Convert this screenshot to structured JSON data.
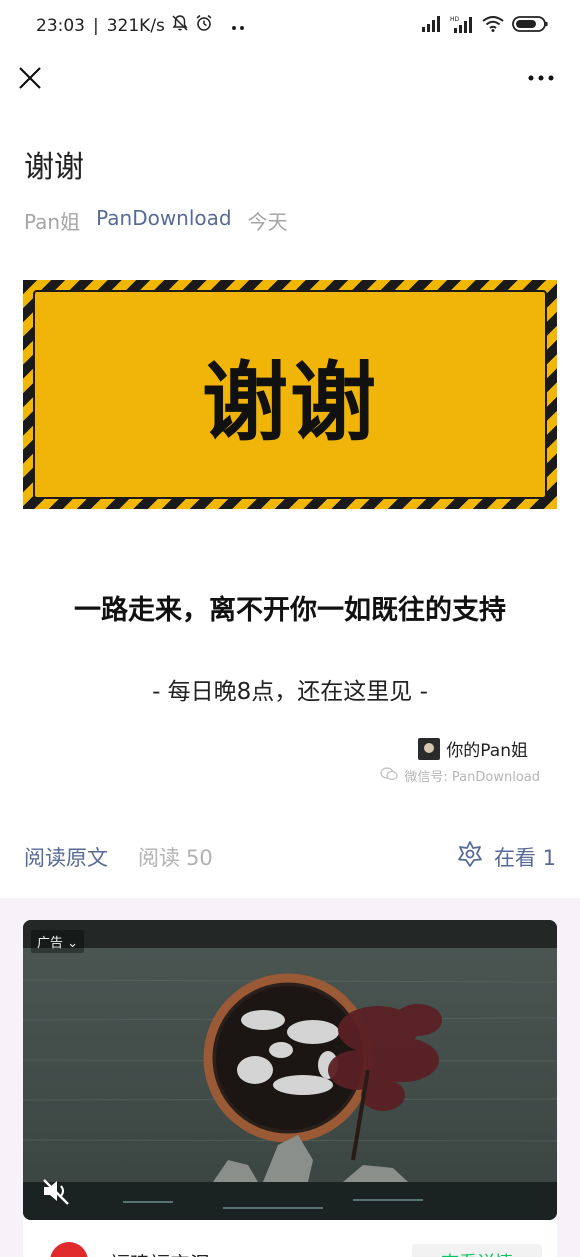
{
  "status_bar": {
    "time": "23:03",
    "speed": "321K/s",
    "icons": [
      "bell-off-icon",
      "alarm-icon",
      "more-dots-icon",
      "signal-icon",
      "hd-signal-icon",
      "wifi-icon",
      "battery-icon"
    ]
  },
  "nav": {
    "close_icon": "close-icon",
    "more_icon": "more-horizontal-icon"
  },
  "article": {
    "title": "谢谢",
    "author": "Pan姐",
    "account": "PanDownload",
    "date": "今天",
    "banner_text": "谢谢",
    "headline": "一路走来，离不开你一如既往的支持",
    "subline": "- 每日晚8点，还在这里见 -",
    "signature": "你的Pan姐",
    "wechat_id": "微信号: PanDownload"
  },
  "footer": {
    "read_original": "阅读原文",
    "read_label": "阅读",
    "read_count": "50",
    "looking_label": "在看",
    "looking_count": "1"
  },
  "ad": {
    "label": "广告",
    "brand": "福建福宝湿",
    "cta": "查看详情"
  },
  "colors": {
    "link": "#576b95",
    "muted": "#a6a6a6",
    "banner_yellow": "#f0b508",
    "cta_green": "#07c160"
  }
}
